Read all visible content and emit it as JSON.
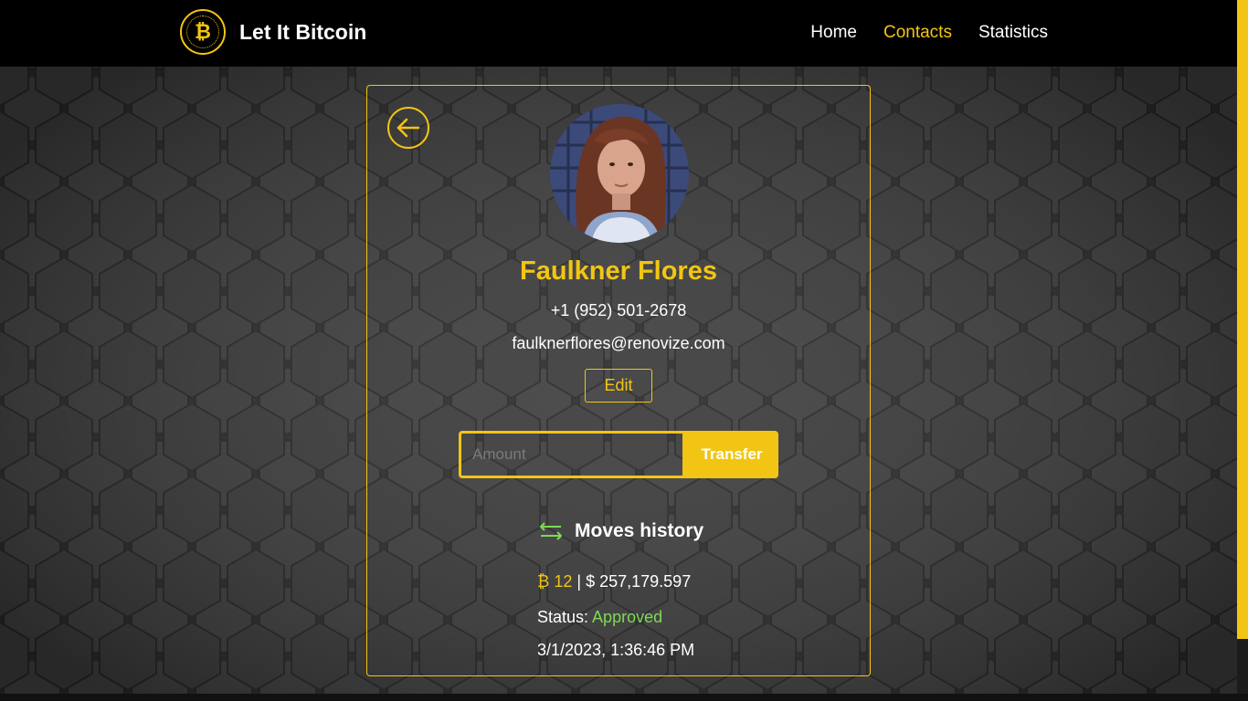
{
  "header": {
    "brand_symbol": "₿",
    "brand_name": "Let It Bitcoin",
    "nav": [
      {
        "label": "Home",
        "active": false
      },
      {
        "label": "Contacts",
        "active": true
      },
      {
        "label": "Statistics",
        "active": false
      }
    ]
  },
  "contact": {
    "name": "Faulkner Flores",
    "phone": "+1 (952) 501-2678",
    "email": "faulknerflores@renovize.com",
    "edit_label": "Edit"
  },
  "transfer": {
    "placeholder": "Amount",
    "value": "",
    "button_label": "Transfer"
  },
  "history": {
    "title": "Moves history",
    "moves": [
      {
        "btc_symbol": "₿",
        "btc_amount": "12",
        "separator": "|",
        "usd_amount": "$ 257,179.597",
        "status_label": "Status:",
        "status": "Approved",
        "date": "3/1/2023, 1:36:46 PM"
      }
    ]
  },
  "colors": {
    "accent": "#f2c514",
    "status_approved": "#7ed957",
    "background": "#2b2b2b",
    "header": "#000000"
  },
  "icons": {
    "logo": "bitcoin-coin-icon",
    "back": "arrow-left-circle-icon",
    "history": "transfer-arrows-icon"
  }
}
